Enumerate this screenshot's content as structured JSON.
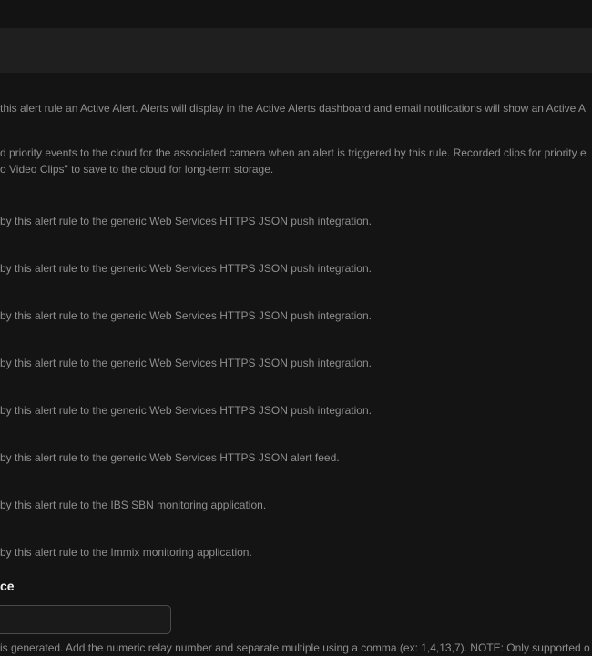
{
  "descriptions": {
    "active_alert": "this alert rule an Active Alert. Alerts will display in the Active Alerts dashboard and email notifications will show an Active A",
    "priority_line1": "d priority events to the cloud for the associated camera when an alert is triggered by this rule. Recorded clips for priority e",
    "priority_line2": "o Video Clips\" to save to the cloud for long-term storage.",
    "push_1": "by this alert rule to the generic Web Services HTTPS JSON push integration.",
    "push_2": "by this alert rule to the generic Web Services HTTPS JSON push integration.",
    "push_3": "by this alert rule to the generic Web Services HTTPS JSON push integration.",
    "push_4": "by this alert rule to the generic Web Services HTTPS JSON push integration.",
    "push_5": "by this alert rule to the generic Web Services HTTPS JSON push integration.",
    "alert_feed": "by this alert rule to the generic Web Services HTTPS JSON alert feed.",
    "ibs_sbn": "by this alert rule to the IBS SBN monitoring application.",
    "immix": "by this alert rule to the Immix monitoring application."
  },
  "relay": {
    "label": "ce",
    "value": "",
    "help": "is generated. Add the numeric relay number and separate multiple using a comma (ex: 1,4,13,7). NOTE: Only supported o"
  }
}
